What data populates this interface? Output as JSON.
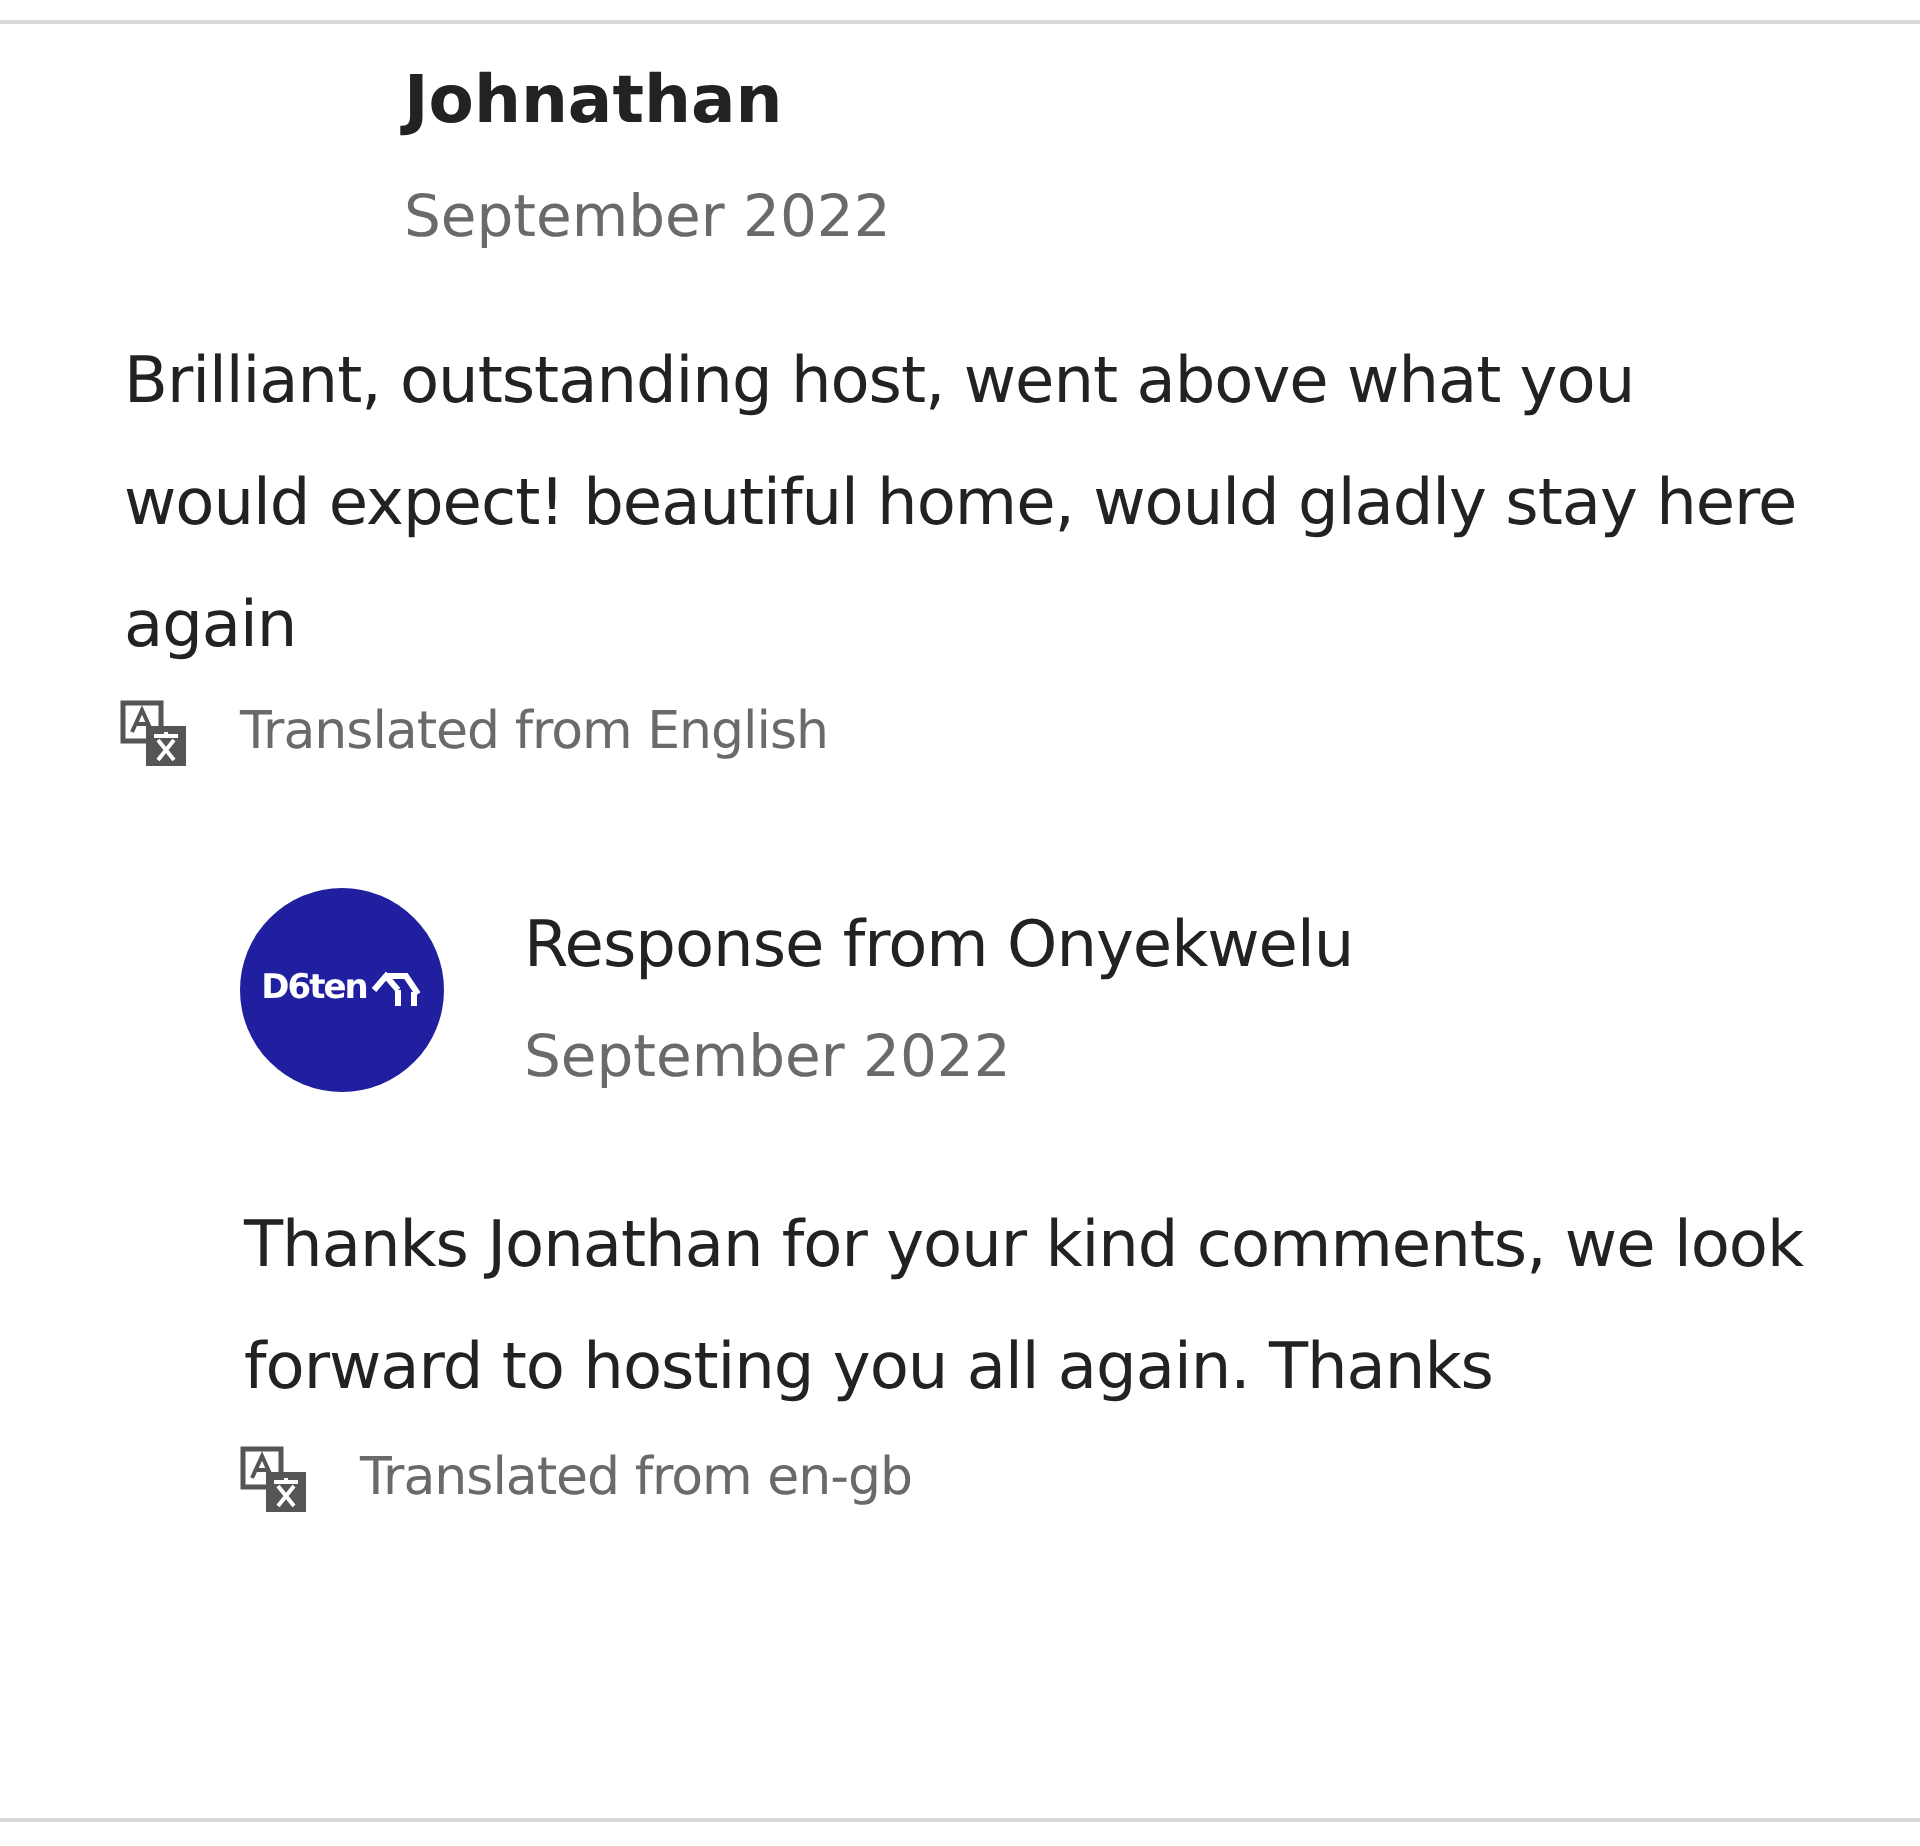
{
  "review": {
    "author": "Johnathan",
    "date": "September 2022",
    "text": "Brilliant, outstanding host, went above what you would expect! beautiful home, would gladly stay here again",
    "translation_note": "Translated from English"
  },
  "response": {
    "logo_text": "D6ten",
    "title": "Response from Onyekwelu",
    "date": "September 2022",
    "text": "Thanks Jonathan for your kind comments, we look forward to hosting you all again. Thanks",
    "translation_note": "Translated from en-gb"
  }
}
